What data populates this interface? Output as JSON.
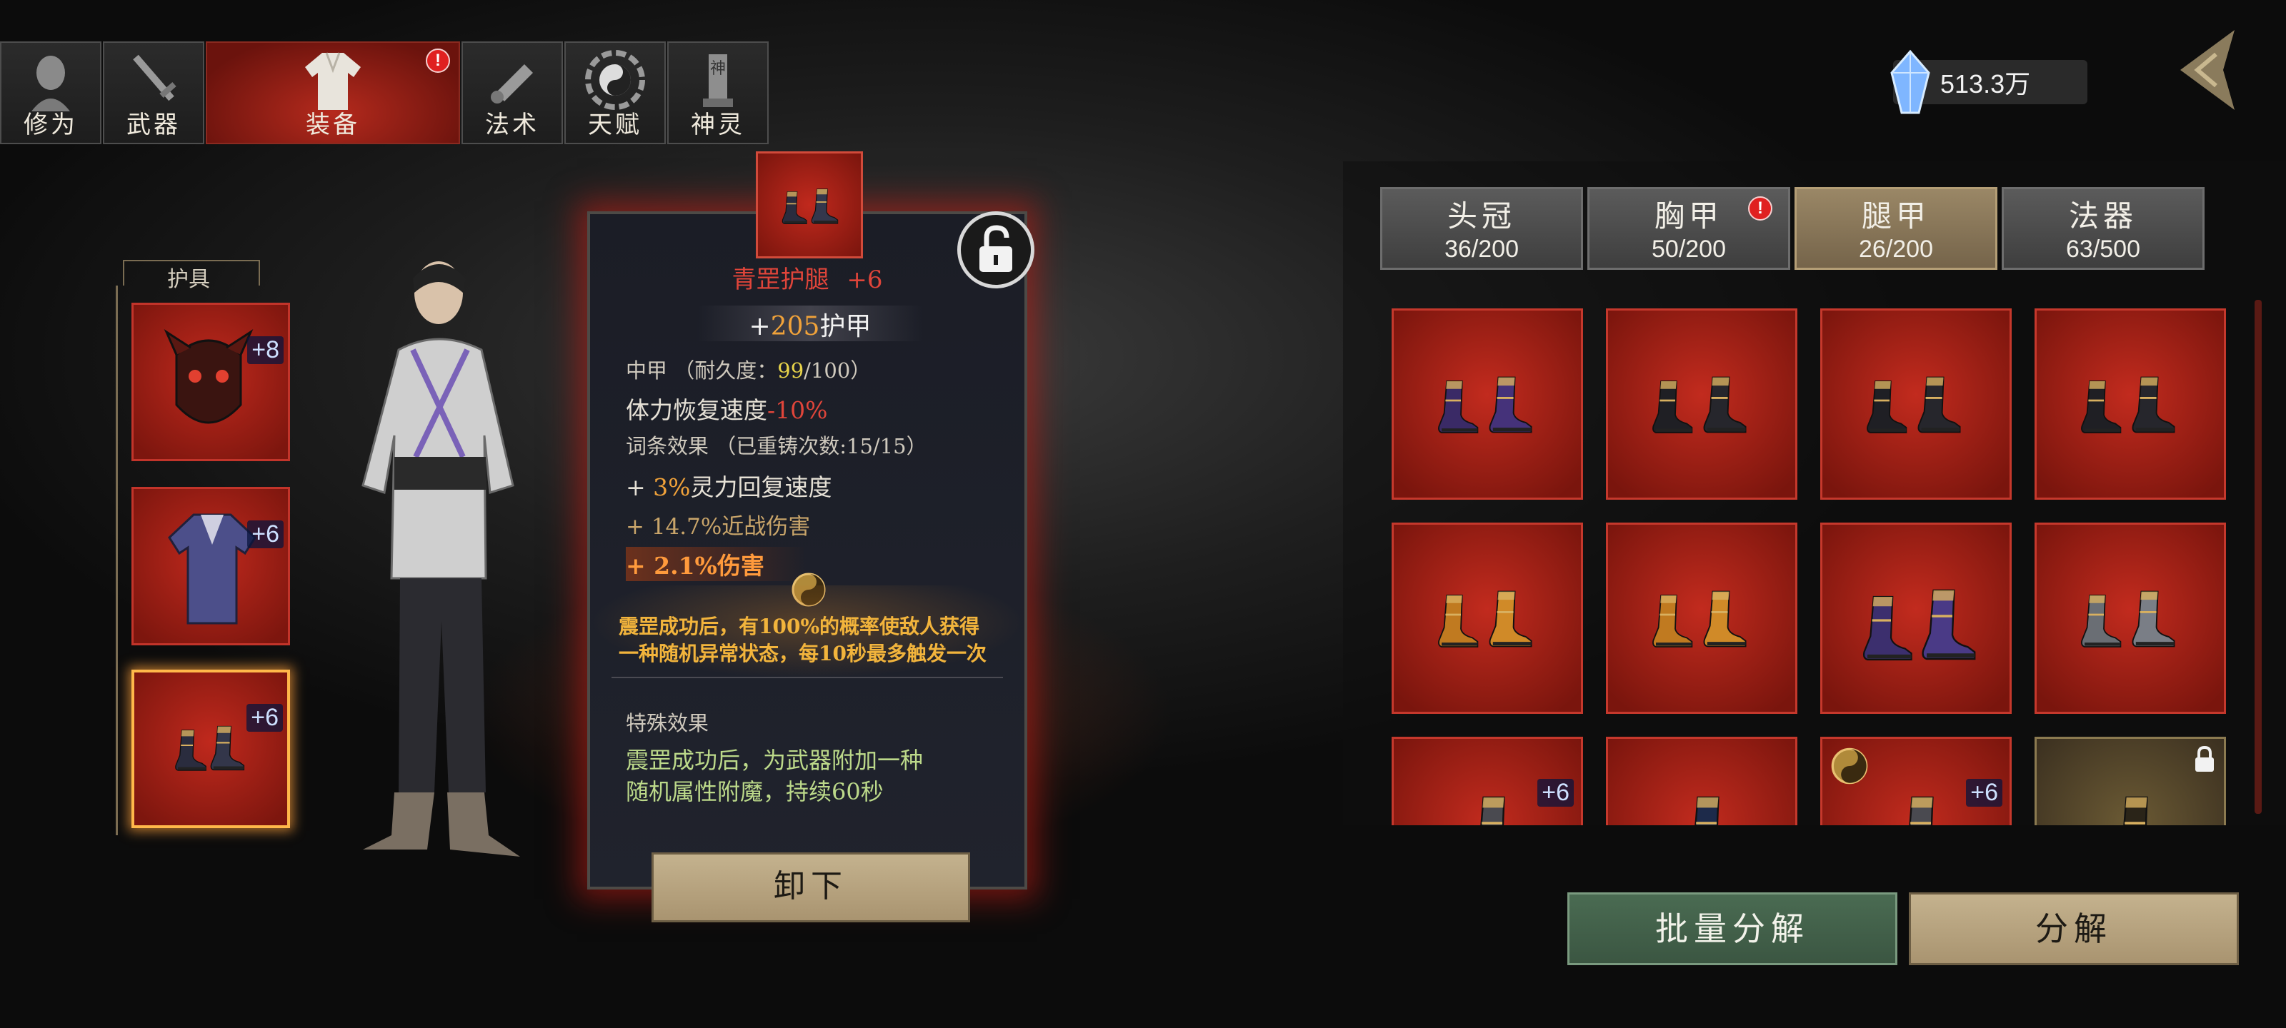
{
  "tabs": [
    {
      "label": "修为"
    },
    {
      "label": "武器"
    },
    {
      "label": "装备",
      "alert": "!"
    },
    {
      "label": "法术"
    },
    {
      "label": "天赋"
    },
    {
      "label": "神灵",
      "icon_text": "神"
    }
  ],
  "currency": {
    "value": "513.3万",
    "icon": "crystal-icon"
  },
  "left": {
    "section_title": "护具",
    "slots": [
      {
        "name": "helmet",
        "badge": "+8"
      },
      {
        "name": "chest",
        "badge": "+6"
      },
      {
        "name": "boots",
        "badge": "+6",
        "selected": true
      }
    ]
  },
  "detail": {
    "name": "青罡护腿",
    "level": "+6",
    "armor_prefix": "+",
    "armor_value": "205",
    "armor_label": "护甲",
    "type": "中甲",
    "durability_label": "（耐久度：",
    "durability_value": "99",
    "durability_max": "/100）",
    "stamina_label": "体力恢复速度",
    "stamina_value": "-10%",
    "affix_title": "词条效果",
    "affix_reforge": "（已重铸次数:15/15）",
    "affix1_prefix": "+ ",
    "affix1_value": "3%",
    "affix1_label": "灵力回复速度",
    "affix2": "+ 14.7%近战伤害",
    "affix3": "+ 2.1%伤害",
    "set_line1": "震罡成功后，有100%的概率使敌人获得",
    "set_line2": "一种随机异常状态，每10秒最多触发一次",
    "special_title": "特殊效果",
    "special_line1": "震罡成功后，为武器附加一种",
    "special_line2": "随机属性附魔，持续60秒",
    "unequip": "卸下"
  },
  "categories": [
    {
      "name": "头冠",
      "count": "36/200"
    },
    {
      "name": "胸甲",
      "count": "50/200",
      "alert": "!"
    },
    {
      "name": "腿甲",
      "count": "26/200",
      "active": true
    },
    {
      "name": "法器",
      "count": "63/500"
    }
  ],
  "inventory": [
    {
      "style": "purple-gold"
    },
    {
      "style": "black-red"
    },
    {
      "style": "black-red"
    },
    {
      "style": "black-red"
    },
    {
      "style": "orange-blue"
    },
    {
      "style": "orange-blue"
    },
    {
      "style": "purple-floral"
    },
    {
      "style": "silver-dragon"
    },
    {
      "style": "dragon",
      "badge": "+6"
    },
    {
      "style": "blue-black"
    },
    {
      "style": "dragon",
      "badge": "+6",
      "set_icon": true
    },
    {
      "style": "gold",
      "locked": true
    }
  ],
  "actions": {
    "batch_decompose": "批量分解",
    "decompose": "分解"
  },
  "colors": {
    "accent_red": "#c0291d",
    "gold_text": "#f0b84a",
    "highlight": "#ff9a3c",
    "green_text": "#bcd98a"
  }
}
